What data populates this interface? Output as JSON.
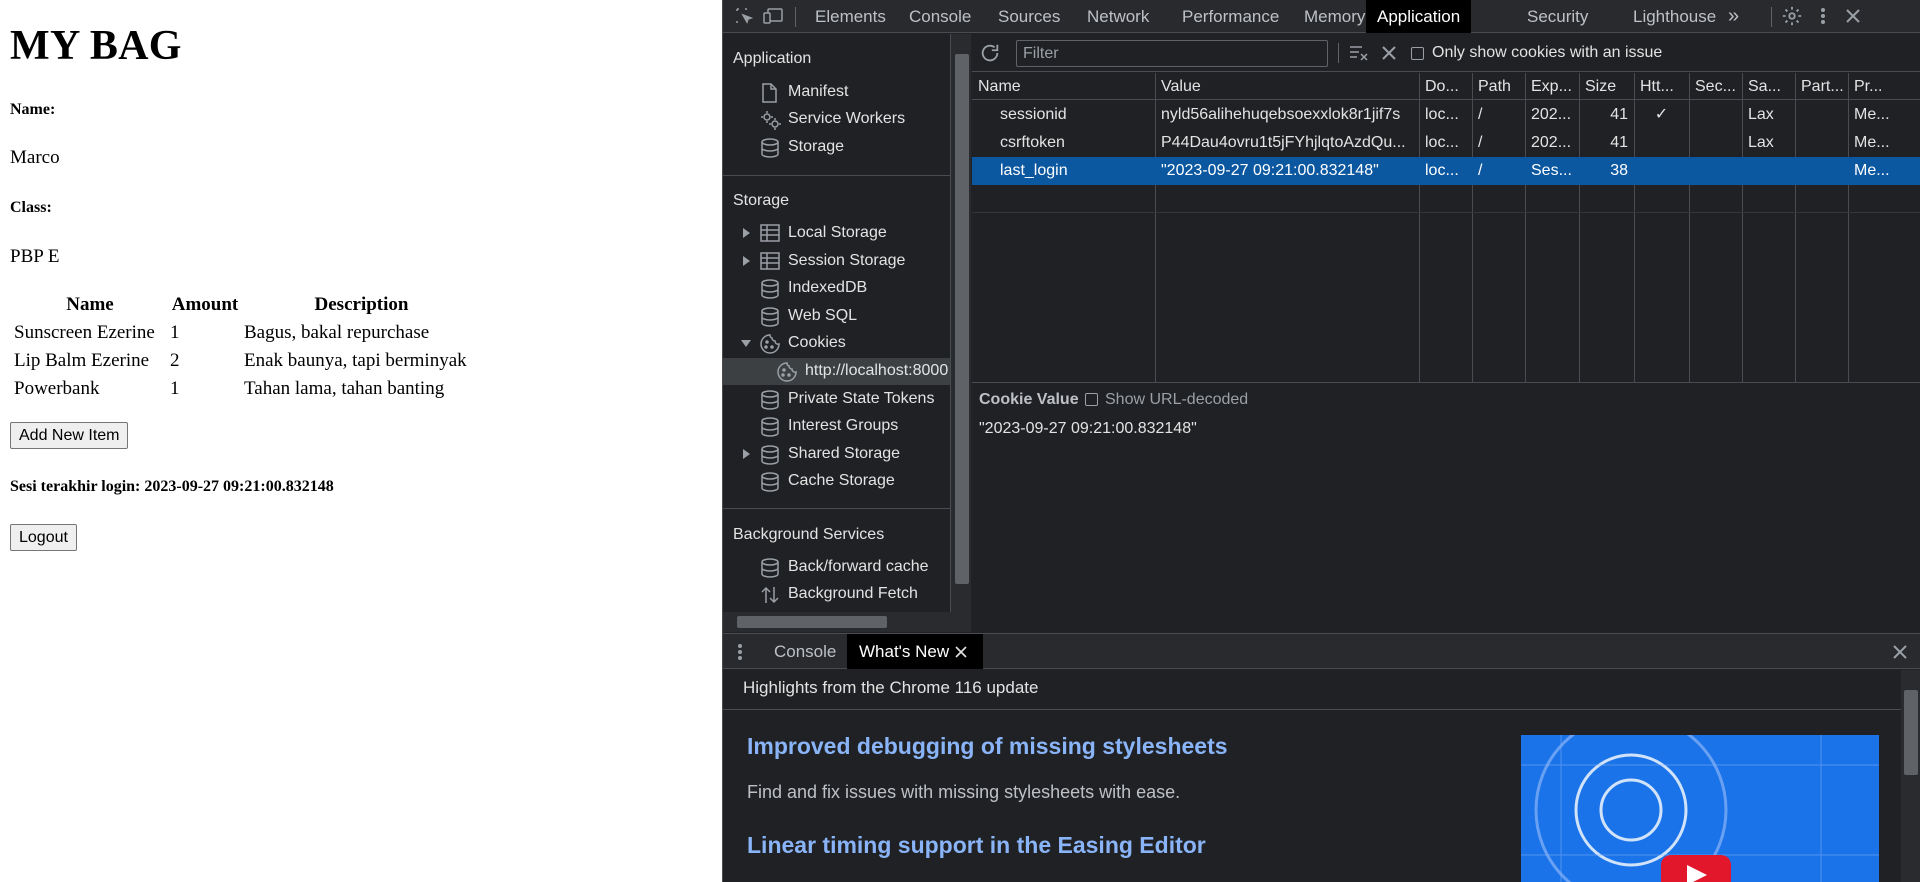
{
  "page": {
    "title": "MY BAG",
    "name_label": "Name:",
    "name_value": "Marco",
    "class_label": "Class:",
    "class_value": "PBP E",
    "table_headers": [
      "Name",
      "Amount",
      "Description"
    ],
    "items": [
      {
        "name": "Sunscreen Ezerine",
        "amount": "1",
        "description": "Bagus, bakal repurchase"
      },
      {
        "name": "Lip Balm Ezerine",
        "amount": "2",
        "description": "Enak baunya, tapi berminyak"
      },
      {
        "name": "Powerbank",
        "amount": "1",
        "description": "Tahan lama, tahan banting"
      }
    ],
    "add_button": "Add New Item",
    "last_login_text": "Sesi terakhir login: 2023-09-27 09:21:00.832148",
    "logout_button": "Logout"
  },
  "devtools": {
    "tabs": [
      "Elements",
      "Console",
      "Sources",
      "Network",
      "Performance",
      "Memory",
      "Application",
      "Security",
      "Lighthouse"
    ],
    "active_tab": "Application",
    "more_tabs_glyph": "»",
    "sidebar": {
      "application_header": "Application",
      "application_items": [
        "Manifest",
        "Service Workers",
        "Storage"
      ],
      "storage_header": "Storage",
      "storage_items": [
        "Local Storage",
        "Session Storage",
        "IndexedDB",
        "Web SQL",
        "Cookies",
        "http://localhost:8000",
        "Private State Tokens",
        "Interest Groups",
        "Shared Storage",
        "Cache Storage"
      ],
      "background_header": "Background Services",
      "background_items": [
        "Back/forward cache",
        "Background Fetch"
      ]
    },
    "cookies": {
      "filter_placeholder": "Filter",
      "only_issues_label": "Only show cookies with an issue",
      "columns": [
        "Name",
        "Value",
        "Do...",
        "Path",
        "Exp...",
        "Size",
        "Htt...",
        "Sec...",
        "Sa...",
        "Part...",
        "Pr..."
      ],
      "rows": [
        {
          "name": "sessionid",
          "value": "nyld56alihehuqebsoexxlok8r1jif7s",
          "domain": "loc...",
          "path": "/",
          "expires": "202...",
          "size": "41",
          "httponly": "✓",
          "secure": "",
          "samesite": "Lax",
          "partition": "",
          "priority": "Me..."
        },
        {
          "name": "csrftoken",
          "value": "P44Dau4ovru1t5jFYhjlqtoAzdQu...",
          "domain": "loc...",
          "path": "/",
          "expires": "202...",
          "size": "41",
          "httponly": "",
          "secure": "",
          "samesite": "Lax",
          "partition": "",
          "priority": "Me..."
        },
        {
          "name": "last_login",
          "value": "\"2023-09-27 09:21:00.832148\"",
          "domain": "loc...",
          "path": "/",
          "expires": "Ses...",
          "size": "38",
          "httponly": "",
          "secure": "",
          "samesite": "",
          "partition": "",
          "priority": "Me..."
        }
      ],
      "selected_row": 2,
      "value_pane_title": "Cookie Value",
      "show_decoded_label": "Show URL-decoded",
      "value_pane_value": "\"2023-09-27 09:21:00.832148\""
    },
    "drawer": {
      "tabs": [
        "Console",
        "What's New"
      ],
      "active_tab": "What's New",
      "highlights": "Highlights from the Chrome 116 update",
      "items": [
        {
          "title": "Improved debugging of missing stylesheets",
          "desc": "Find and fix issues with missing stylesheets with ease."
        },
        {
          "title": "Linear timing support in the Easing Editor",
          "desc": ""
        }
      ]
    },
    "colors": {
      "selected_row": "#0b57a0",
      "link": "#8ab4f8",
      "active_tab_bg": "#000000"
    }
  }
}
